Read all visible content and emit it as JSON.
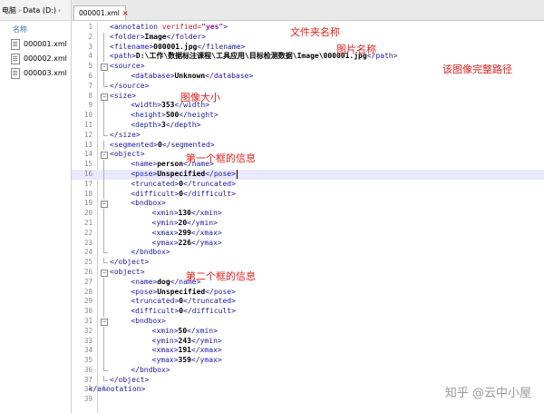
{
  "explorer": {
    "breadcrumb": [
      "电脑",
      "Data (D:)"
    ],
    "column_header": "名称",
    "files": [
      "000001.xml",
      "000002.xml",
      "000003.xml"
    ]
  },
  "editor": {
    "tab_label": "000001.xml",
    "highlighted_line": 16,
    "lines": [
      [
        [
          "tag",
          "<annotation "
        ],
        [
          "attr",
          "verified="
        ],
        [
          "aval",
          "\"yes\""
        ],
        [
          "tag",
          ">"
        ]
      ],
      [
        [
          "tag",
          "<folder>"
        ],
        [
          "val",
          "Image"
        ],
        [
          "tag",
          "</folder>"
        ]
      ],
      [
        [
          "tag",
          "<filename>"
        ],
        [
          "val",
          "000001.jpg"
        ],
        [
          "tag",
          "</filename>"
        ]
      ],
      [
        [
          "tag",
          "<path>"
        ],
        [
          "val",
          "D:\\工作\\数据标注课程\\工具应用\\目标检测数据\\Image\\000001.jpg"
        ],
        [
          "tag",
          "</path>"
        ]
      ],
      [
        [
          "tag",
          "<source>"
        ]
      ],
      [
        [
          "tag",
          "<database>"
        ],
        [
          "val",
          "Unknown"
        ],
        [
          "tag",
          "</database>"
        ]
      ],
      [
        [
          "tag",
          "</source>"
        ]
      ],
      [
        [
          "tag",
          "<size>"
        ]
      ],
      [
        [
          "tag",
          "<width>"
        ],
        [
          "val",
          "353"
        ],
        [
          "tag",
          "</width>"
        ]
      ],
      [
        [
          "tag",
          "<height>"
        ],
        [
          "val",
          "500"
        ],
        [
          "tag",
          "</height>"
        ]
      ],
      [
        [
          "tag",
          "<depth>"
        ],
        [
          "val",
          "3"
        ],
        [
          "tag",
          "</depth>"
        ]
      ],
      [
        [
          "tag",
          "</size>"
        ]
      ],
      [
        [
          "tag",
          "<segmented>"
        ],
        [
          "val",
          "0"
        ],
        [
          "tag",
          "</segmented>"
        ]
      ],
      [
        [
          "tag",
          "<object>"
        ]
      ],
      [
        [
          "tag",
          "<name>"
        ],
        [
          "val",
          "person"
        ],
        [
          "tag",
          "</name>"
        ]
      ],
      [
        [
          "tag",
          "<pose>"
        ],
        [
          "val",
          "Unspecified"
        ],
        [
          "tag",
          "</pose>"
        ]
      ],
      [
        [
          "tag",
          "<truncated>"
        ],
        [
          "val",
          "0"
        ],
        [
          "tag",
          "</truncated>"
        ]
      ],
      [
        [
          "tag",
          "<difficult>"
        ],
        [
          "val",
          "0"
        ],
        [
          "tag",
          "</difficult>"
        ]
      ],
      [
        [
          "tag",
          "<bndbox>"
        ]
      ],
      [
        [
          "tag",
          "<xmin>"
        ],
        [
          "val",
          "130"
        ],
        [
          "tag",
          "</xmin>"
        ]
      ],
      [
        [
          "tag",
          "<ymin>"
        ],
        [
          "val",
          "20"
        ],
        [
          "tag",
          "</ymin>"
        ]
      ],
      [
        [
          "tag",
          "<xmax>"
        ],
        [
          "val",
          "299"
        ],
        [
          "tag",
          "</xmax>"
        ]
      ],
      [
        [
          "tag",
          "<ymax>"
        ],
        [
          "val",
          "226"
        ],
        [
          "tag",
          "</ymax>"
        ]
      ],
      [
        [
          "tag",
          "</bndbox>"
        ]
      ],
      [
        [
          "tag",
          "</object>"
        ]
      ],
      [
        [
          "tag",
          "<object>"
        ]
      ],
      [
        [
          "tag",
          "<name>"
        ],
        [
          "val",
          "dog"
        ],
        [
          "tag",
          "</name>"
        ]
      ],
      [
        [
          "tag",
          "<pose>"
        ],
        [
          "val",
          "Unspecified"
        ],
        [
          "tag",
          "</pose>"
        ]
      ],
      [
        [
          "tag",
          "<truncated>"
        ],
        [
          "val",
          "0"
        ],
        [
          "tag",
          "</truncated>"
        ]
      ],
      [
        [
          "tag",
          "<difficult>"
        ],
        [
          "val",
          "0"
        ],
        [
          "tag",
          "</difficult>"
        ]
      ],
      [
        [
          "tag",
          "<bndbox>"
        ]
      ],
      [
        [
          "tag",
          "<xmin>"
        ],
        [
          "val",
          "50"
        ],
        [
          "tag",
          "</xmin>"
        ]
      ],
      [
        [
          "tag",
          "<ymin>"
        ],
        [
          "val",
          "243"
        ],
        [
          "tag",
          "</ymin>"
        ]
      ],
      [
        [
          "tag",
          "<xmax>"
        ],
        [
          "val",
          "191"
        ],
        [
          "tag",
          "</xmax>"
        ]
      ],
      [
        [
          "tag",
          "<ymax>"
        ],
        [
          "val",
          "359"
        ],
        [
          "tag",
          "</ymax>"
        ]
      ],
      [
        [
          "tag",
          "</bndbox>"
        ]
      ],
      [
        [
          "tag",
          "</object>"
        ]
      ],
      [
        [
          "tag",
          "</annotation>"
        ]
      ],
      []
    ]
  },
  "annotations": {
    "folder_note": "文件夹名称",
    "filename_note": "图片名称",
    "path_note": "该图像完整路径",
    "size_note": "图像大小",
    "object1_note": "第一个框的信息",
    "object2_note": "第二个框的信息"
  },
  "watermark": "知乎 @云中小屋",
  "colors": {
    "tag": "#1a1aa6",
    "attribute": "#cc2222",
    "attribute_value": "#8a1aa6",
    "annotation": "#e8201a",
    "highlight_line": "#e8e8ff"
  }
}
